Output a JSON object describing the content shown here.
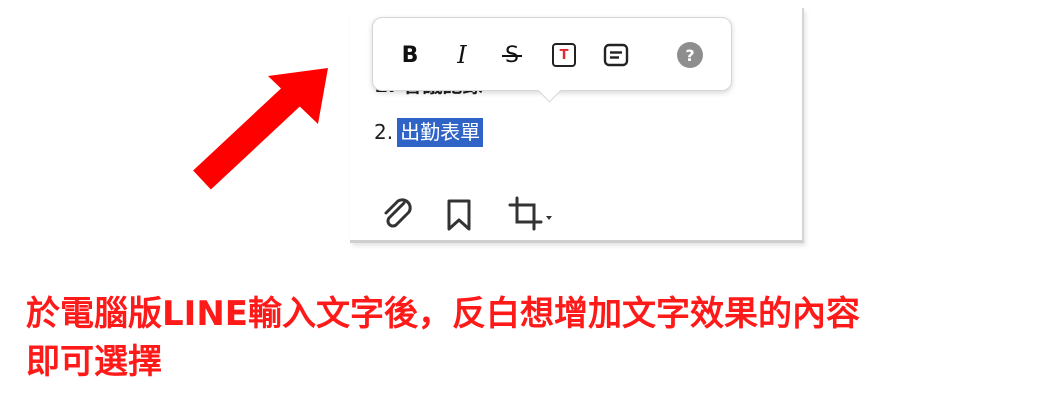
{
  "editor": {
    "list": [
      {
        "number": "1.",
        "text": "會議記錄"
      },
      {
        "number": "2.",
        "text": "出勤表單"
      }
    ]
  },
  "toolbar": {
    "bold_label": "B",
    "italic_label": "I",
    "strike_label": "S",
    "color_label": "T",
    "help_label": "?",
    "icons": [
      "bold-icon",
      "italic-icon",
      "strikethrough-icon",
      "text-color-icon",
      "text-block-icon",
      "help-icon"
    ]
  },
  "bottom_bar": {
    "icons": [
      "paperclip-icon",
      "bookmark-icon",
      "crop-icon",
      "caret-down-icon"
    ]
  },
  "annotation": {
    "caption_line1": "於電腦版LINE輸入文字後，反白想增加文字效果的內容",
    "caption_line2": "即可選擇",
    "color": "#ff1a1a"
  },
  "colors": {
    "selection": "#2f63c6",
    "text_color_accent": "#e8262f",
    "help_bg": "#8e8e8e"
  }
}
